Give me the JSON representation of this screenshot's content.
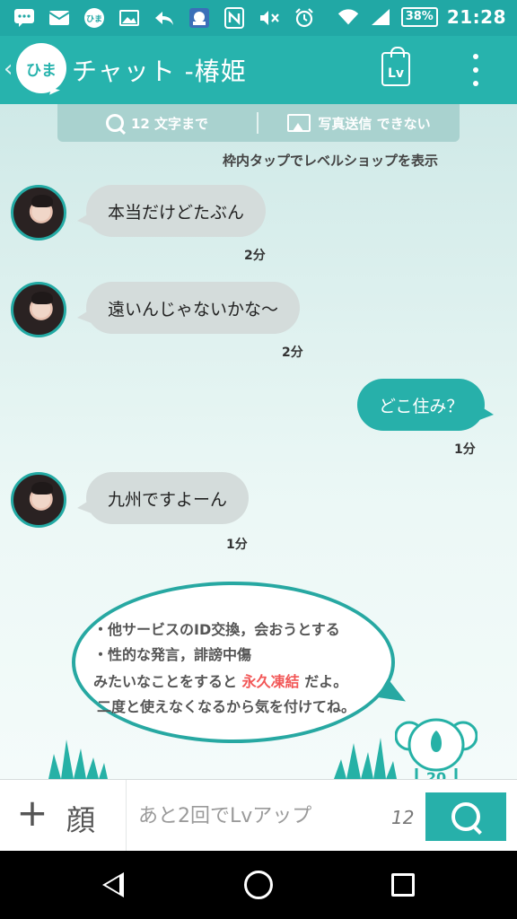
{
  "status_bar": {
    "battery": "38%",
    "time": "21:28"
  },
  "app_bar": {
    "logo_text": "ひま",
    "title": "チャット -椿姫",
    "level_icon": "Lv"
  },
  "info_strip": {
    "char_limit": "12 文字まで",
    "photo_status": "写真送信  できない"
  },
  "hint": "枠内タップでレベルショップを表示",
  "messages": [
    {
      "from": "other",
      "text": "本当だけどたぶん",
      "time": "2分"
    },
    {
      "from": "other",
      "text": "遠いんじゃないかな～",
      "time": "2分"
    },
    {
      "from": "me",
      "text": "どこ住み？",
      "time": "1分"
    },
    {
      "from": "other",
      "text": "九州ですよーん",
      "time": "1分"
    }
  ],
  "notice": {
    "line1": "・他サービスのID交換，会おうとする",
    "line2": "・性的な発言，誹謗中傷",
    "line3_pre": "みたいなことをすると",
    "line3_red": "永久凍結",
    "line3_post": "だよ。",
    "line4": "二度と使えなくなるから気を付けてね。"
  },
  "mascot_number": "20",
  "input_bar": {
    "plus_label": "+",
    "face_label": "顔",
    "placeholder": "あと2回でLvアップ",
    "counter": "12"
  },
  "colors": {
    "accent": "#27b0aa",
    "status_bar": "#21a8a5",
    "warning_red": "#f25757"
  }
}
